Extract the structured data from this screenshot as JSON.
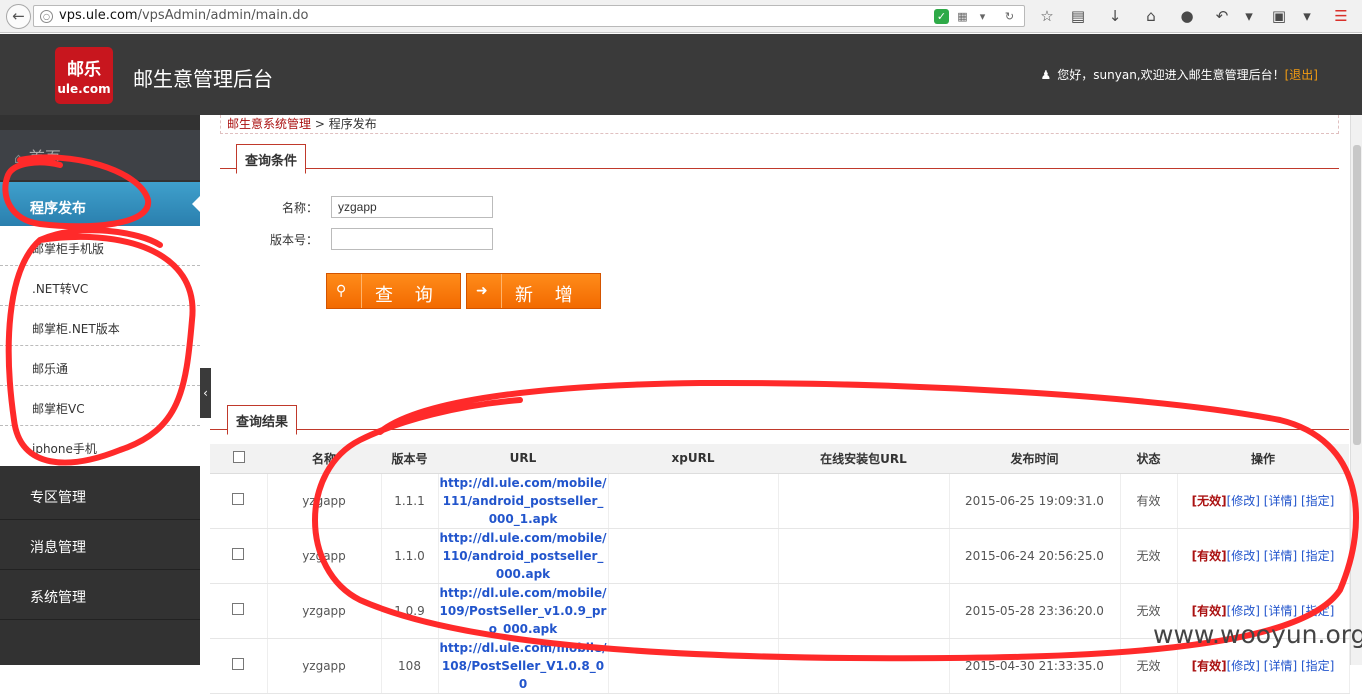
{
  "browser": {
    "url_host": "vps.ule.com",
    "url_path": "/vpsAdmin/admin/main.do"
  },
  "header": {
    "logo_top": "邮乐",
    "logo_bottom": "ule.com",
    "title": "邮生意管理后台",
    "greeting": "您好，sunyan,欢迎进入邮生意管理后台！",
    "logout": "[退出]"
  },
  "sidebar": {
    "home": "首页",
    "active": "程序发布",
    "sub_items": [
      "邮掌柜手机版",
      ".NET转VC",
      "邮掌柜.NET版本",
      "邮乐通",
      "邮掌柜VC",
      "iphone手机"
    ],
    "sections": [
      "专区管理",
      "消息管理",
      "系统管理"
    ]
  },
  "breadcrumb": {
    "link": "邮生意系统管理",
    "sep": ">",
    "current": "程序发布"
  },
  "query": {
    "tab": "查询条件",
    "name_label": "名称：",
    "name_value": "yzgapp",
    "version_label": "版本号：",
    "version_value": "",
    "search_button": "查 询",
    "add_button": "新 增"
  },
  "results": {
    "tab": "查询结果",
    "columns": [
      "名称",
      "版本号",
      "URL",
      "xpURL",
      "在线安装包URL",
      "发布时间",
      "状态",
      "操作"
    ],
    "rows": [
      {
        "name": "yzgapp",
        "version": "1.1.1",
        "url": "http://dl.ule.com/mobile/111/android_postseller_000_1.apk",
        "xpurl": "",
        "online_url": "",
        "time": "2015-06-25 19:09:31.0",
        "status": "有效",
        "op_toggle": "[无效]"
      },
      {
        "name": "yzgapp",
        "version": "1.1.0",
        "url": "http://dl.ule.com/mobile/110/android_postseller_000.apk",
        "xpurl": "",
        "online_url": "",
        "time": "2015-06-24 20:56:25.0",
        "status": "无效",
        "op_toggle": "[有效]"
      },
      {
        "name": "yzgapp",
        "version": "1.0.9",
        "url": "http://dl.ule.com/mobile/109/PostSeller_v1.0.9_pro_000.apk",
        "xpurl": "",
        "online_url": "",
        "time": "2015-05-28 23:36:20.0",
        "status": "无效",
        "op_toggle": "[有效]"
      },
      {
        "name": "yzgapp",
        "version": "108",
        "url": "http://dl.ule.com/mobile/108/PostSeller_V1.0.8_00",
        "xpurl": "",
        "online_url": "",
        "time": "2015-04-30 21:33:35.0",
        "status": "无效",
        "op_toggle": "[有效]"
      }
    ],
    "op_edit": "[修改]",
    "op_detail": "[详情]",
    "op_assign": "[指定]"
  },
  "watermark": "www.wooyun.org",
  "colors": {
    "annotation": "#ff2a2a",
    "accent": "#f26a00",
    "active_nav": "#3498c8"
  }
}
